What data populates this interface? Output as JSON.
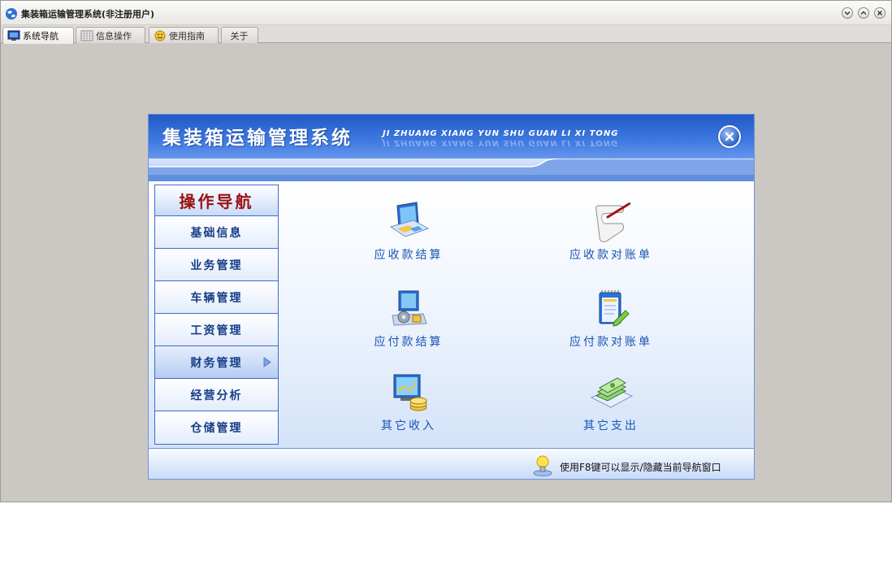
{
  "window": {
    "title": "集装箱运输管理系统(非注册用户)",
    "icon": "globe-app-icon",
    "controls": [
      "minimize-icon",
      "restore-icon",
      "close-icon"
    ]
  },
  "tabs": [
    {
      "label": "系统导航",
      "icon": "monitor-icon",
      "active": true
    },
    {
      "label": "信息操作",
      "icon": "grid-icon",
      "active": false
    },
    {
      "label": "使用指南",
      "icon": "smiley-icon",
      "active": false
    },
    {
      "label": "关于",
      "icon": "",
      "active": false
    }
  ],
  "nav_panel": {
    "title": "集装箱运输管理系统",
    "subtitle": "JI ZHUANG XIANG YUN SHU GUAN LI XI TONG",
    "menu": {
      "heading": "操作导航",
      "items": [
        {
          "label": "基础信息",
          "active": false
        },
        {
          "label": "业务管理",
          "active": false
        },
        {
          "label": "车辆管理",
          "active": false
        },
        {
          "label": "工资管理",
          "active": false
        },
        {
          "label": "财务管理",
          "active": true
        },
        {
          "label": "经营分析",
          "active": false
        },
        {
          "label": "仓储管理",
          "active": false
        }
      ]
    },
    "functions": [
      {
        "label": "应收款结算",
        "icon": "monitor-map-icon"
      },
      {
        "label": "应收款对账单",
        "icon": "scroll-pen-icon"
      },
      {
        "label": "应付款结算",
        "icon": "computer-settings-icon"
      },
      {
        "label": "应付款对账单",
        "icon": "notepad-pencil-icon"
      },
      {
        "label": "其它收入",
        "icon": "monitor-coins-icon"
      },
      {
        "label": "其它支出",
        "icon": "money-stack-icon"
      }
    ],
    "footer_tip": "使用F8键可以显示/隐藏当前导航窗口"
  },
  "colors": {
    "window_bg": "#cbc7c3",
    "header_blue": "#2159c8",
    "menu_heading": "#9c1010",
    "menu_text": "#163d86",
    "tile_text": "#1a55b3"
  }
}
